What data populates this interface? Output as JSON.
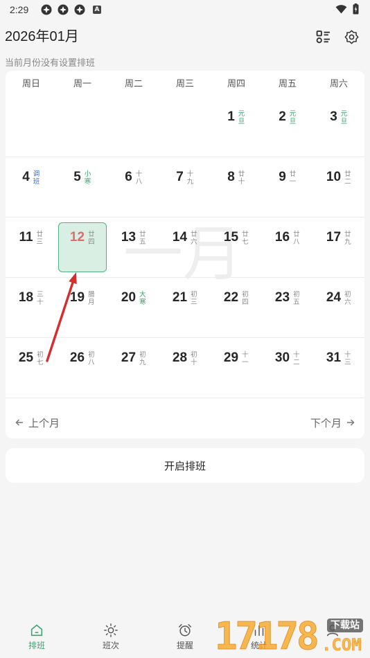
{
  "status_bar": {
    "time": "2:29",
    "notification_icons": [
      "app-notification-icon",
      "app-notification-icon",
      "app-notification-icon"
    ],
    "badge_letter": "A",
    "right_icons": [
      "wifi-icon",
      "battery-icon"
    ]
  },
  "header": {
    "title": "2026年01月",
    "subtitle": "当前月份没有设置排班",
    "icons": [
      "list-view-icon",
      "settings-gear-icon"
    ]
  },
  "calendar": {
    "weekdays": [
      "周日",
      "周一",
      "周二",
      "周三",
      "周四",
      "周五",
      "周六"
    ],
    "month_watermark": "一月",
    "weeks": [
      [
        null,
        null,
        null,
        null,
        {
          "day": 1,
          "lunar": "元旦",
          "lunar_color": "#3ba46e"
        },
        {
          "day": 2,
          "lunar": "元旦",
          "lunar_color": "#3ba46e"
        },
        {
          "day": 3,
          "lunar": "元旦",
          "lunar_color": "#3ba46e"
        }
      ],
      [
        {
          "day": 4,
          "lunar": "调班",
          "lunar_color": "#2f6fd1"
        },
        {
          "day": 5,
          "lunar": "小寒",
          "lunar_color": "#3ba46e"
        },
        {
          "day": 6,
          "lunar": "十八"
        },
        {
          "day": 7,
          "lunar": "十九"
        },
        {
          "day": 8,
          "lunar": "廿十"
        },
        {
          "day": 9,
          "lunar": "廿一"
        },
        {
          "day": 10,
          "lunar": "廿二"
        }
      ],
      [
        {
          "day": 11,
          "lunar": "廿三"
        },
        {
          "day": 12,
          "lunar": "廿四",
          "today": true
        },
        {
          "day": 13,
          "lunar": "廿五"
        },
        {
          "day": 14,
          "lunar": "廿六"
        },
        {
          "day": 15,
          "lunar": "廿七"
        },
        {
          "day": 16,
          "lunar": "廿八"
        },
        {
          "day": 17,
          "lunar": "廿九"
        }
      ],
      [
        {
          "day": 18,
          "lunar": "三十"
        },
        {
          "day": 19,
          "lunar": "腊月"
        },
        {
          "day": 20,
          "lunar": "大寒",
          "lunar_color": "#3ba46e"
        },
        {
          "day": 21,
          "lunar": "初三"
        },
        {
          "day": 22,
          "lunar": "初四"
        },
        {
          "day": 23,
          "lunar": "初五"
        },
        {
          "day": 24,
          "lunar": "初六"
        }
      ],
      [
        {
          "day": 25,
          "lunar": "初七"
        },
        {
          "day": 26,
          "lunar": "初八"
        },
        {
          "day": 27,
          "lunar": "初九"
        },
        {
          "day": 28,
          "lunar": "初十"
        },
        {
          "day": 29,
          "lunar": "十一"
        },
        {
          "day": 30,
          "lunar": "十二"
        },
        {
          "day": 31,
          "lunar": "十三"
        }
      ]
    ],
    "prev_month": "上个月",
    "next_month": "下个月"
  },
  "actions": {
    "start_schedule": "开启排班"
  },
  "bottom_nav": [
    {
      "label": "排班",
      "icon": "home-icon",
      "active": true
    },
    {
      "label": "班次",
      "icon": "sun-icon",
      "active": false
    },
    {
      "label": "提醒",
      "icon": "alarm-clock-icon",
      "active": false
    },
    {
      "label": "统计",
      "icon": "chart-icon",
      "active": false
    },
    {
      "label": "",
      "icon": "person-icon",
      "active": false
    }
  ],
  "colors": {
    "accent": "#3ba46e",
    "holiday_label": "#3ba46e",
    "workday_label": "#2f6fd1",
    "today_number": "#e36a6a",
    "today_fill": "#d9efe4",
    "today_border": "#4fb383",
    "annotation_arrow": "#d32f2f",
    "logo": "#f7a825"
  },
  "logo": {
    "digits": "17178",
    "suffix": ".COM",
    "tag": "下载站"
  }
}
